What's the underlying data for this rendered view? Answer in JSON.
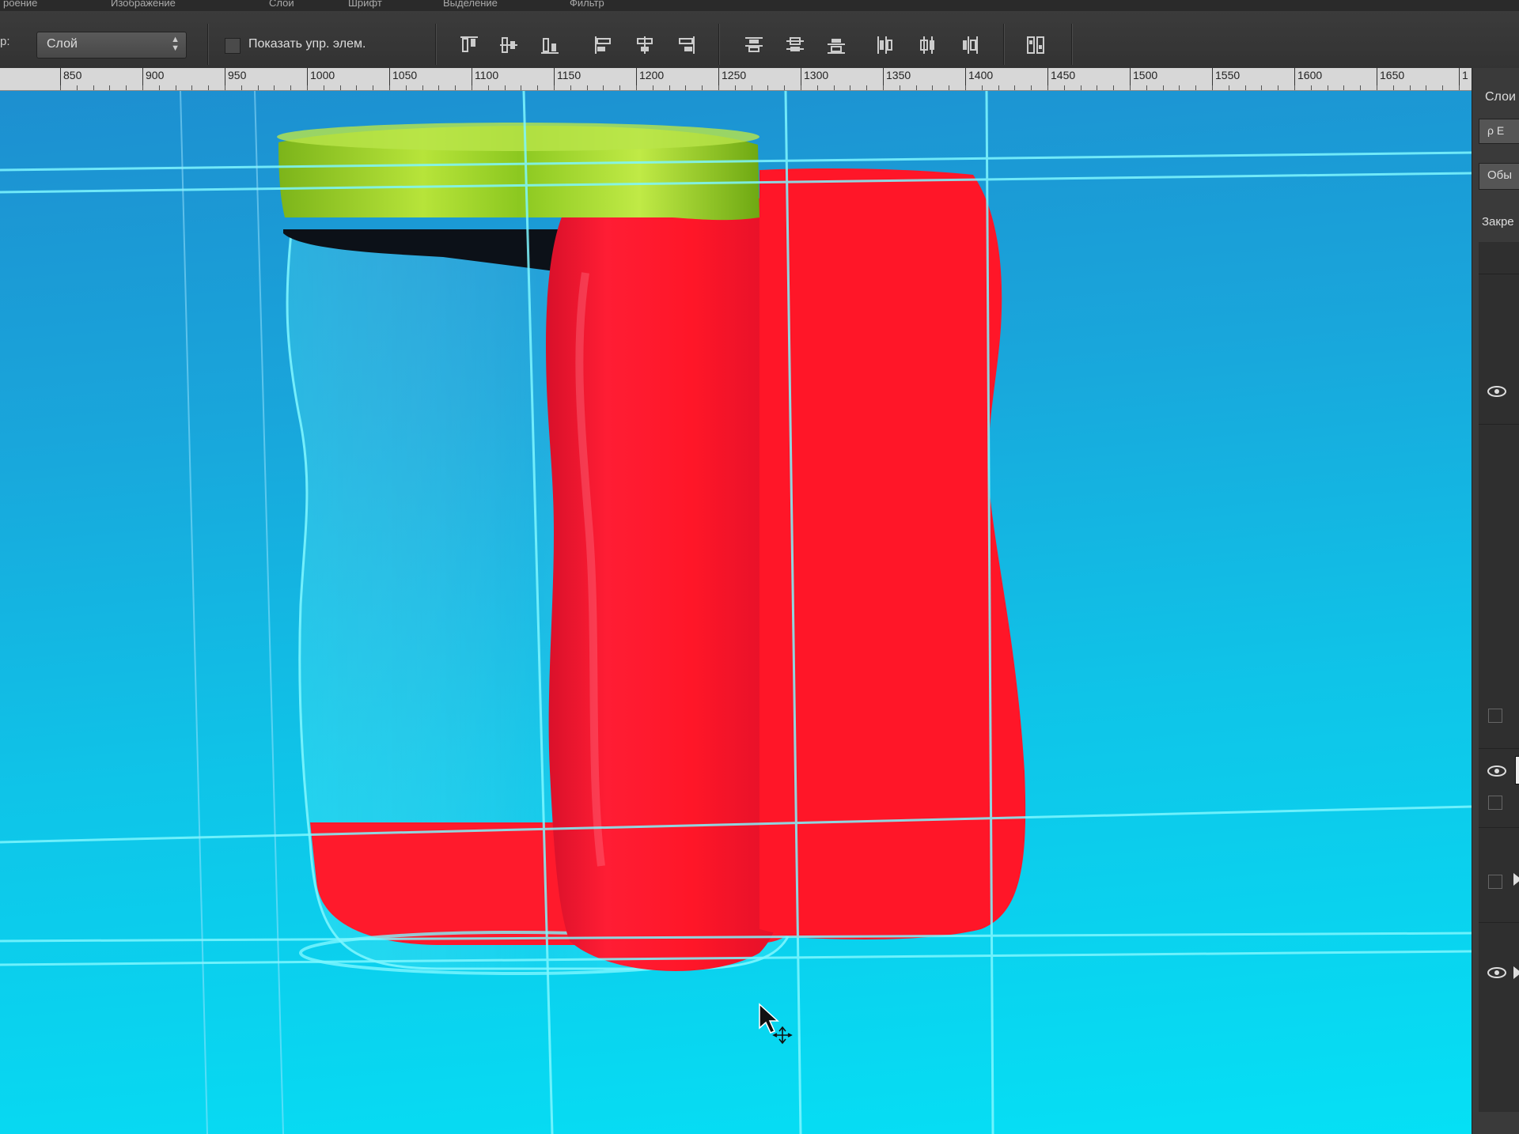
{
  "menubar": {
    "items": [
      "роение",
      "Изображение",
      "Слои",
      "Шрифт",
      "Выделение",
      "Фильтр"
    ]
  },
  "options": {
    "prefix": "р:",
    "layer_select_value": "Слой",
    "show_transform_label": "Показать упр. элем."
  },
  "ruler": {
    "labels": [
      "850",
      "900",
      "950",
      "1000",
      "1050",
      "1100",
      "1150",
      "1200",
      "1250",
      "1300",
      "1350",
      "1400",
      "1450",
      "1500",
      "1550",
      "1600",
      "1650",
      "1"
    ]
  },
  "right_panel": {
    "title": "Слои",
    "search": "ρ Е",
    "blend_mode": "Обы",
    "lock_label": "Закре"
  },
  "icons": {
    "align": [
      "align-top-edges-icon",
      "align-vertical-centers-icon",
      "align-bottom-edges-icon",
      "align-left-edges-icon",
      "align-horizontal-centers-icon",
      "align-right-edges-icon",
      "distribute-top-icon",
      "distribute-vertical-centers-icon",
      "distribute-bottom-icon",
      "distribute-left-icon",
      "distribute-horizontal-centers-icon",
      "distribute-right-icon",
      "auto-align-layers-icon"
    ],
    "panel": [
      "eye-icon",
      "checkbox-icon",
      "expand-arrow-icon",
      "layer-thumbnail-icon"
    ],
    "cursor": "move-cursor-icon"
  },
  "colors": {
    "jar_body": "#ff1628",
    "jar_lid": "#8cc820",
    "background_top": "#1d8fd0",
    "background_bottom": "#05e0f5",
    "guide": "#7ff7ff"
  }
}
